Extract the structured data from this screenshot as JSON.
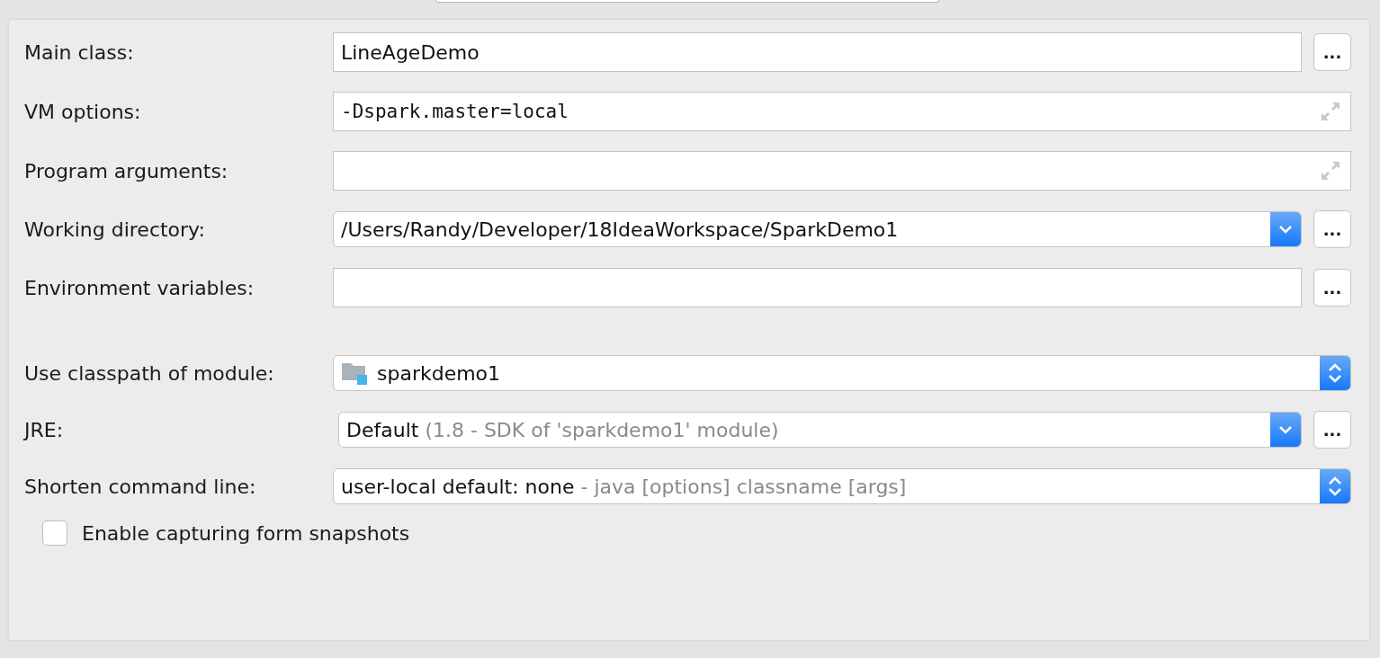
{
  "rows": [
    {
      "kind": "text",
      "label": "Main class:",
      "value": "LineAgeDemo",
      "browse": "..."
    },
    {
      "kind": "expand",
      "label": "VM options:",
      "value": "-Dspark.master=local",
      "mono": true
    },
    {
      "kind": "expand",
      "label": "Program arguments:",
      "value": ""
    },
    {
      "kind": "combo",
      "label": "Working directory:",
      "value": "/Users/Randy/Developer/18IdeaWorkspace/SparkDemo1",
      "browse": "..."
    },
    {
      "kind": "text",
      "label": "Environment variables:",
      "value": "",
      "browse": "..."
    },
    {
      "kind": "module",
      "label": "Use classpath of module:",
      "value": "sparkdemo1"
    },
    {
      "kind": "combo",
      "label": "JRE:",
      "value": "Default",
      "hint": "(1.8 - SDK of 'sparkdemo1' module)",
      "browse": "..."
    },
    {
      "kind": "select",
      "label": "Shorten command line:",
      "value": "user-local default: none",
      "hint": "- java [options] classname [args]"
    }
  ],
  "checkbox": {
    "label": "Enable capturing form snapshots",
    "checked": false
  }
}
